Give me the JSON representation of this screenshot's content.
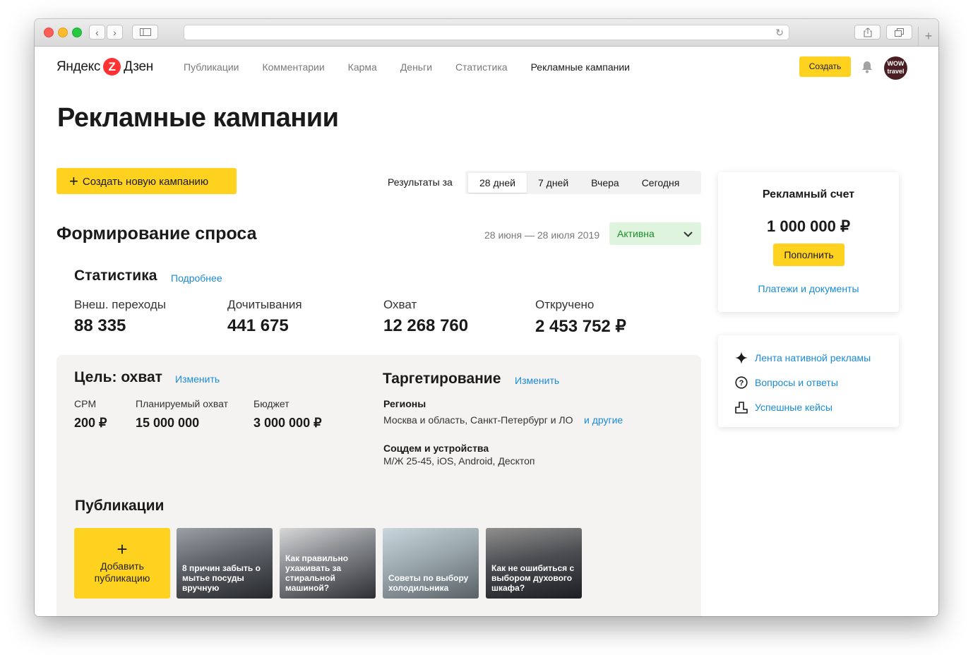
{
  "header": {
    "logo_left": "Яндекс",
    "logo_mark": "Z",
    "logo_right": "Дзен",
    "nav": [
      {
        "label": "Публикации"
      },
      {
        "label": "Комментарии"
      },
      {
        "label": "Карма"
      },
      {
        "label": "Деньги"
      },
      {
        "label": "Статистика"
      },
      {
        "label": "Рекламные кампании"
      }
    ],
    "create_label": "Создать",
    "avatar_text_1": "WOW",
    "avatar_text_2": "travel"
  },
  "page_title": "Рекламные кампании",
  "toolbar": {
    "new_campaign_label": "Создать новую кампанию",
    "period_label": "Результаты за",
    "periods": [
      {
        "label": "28 дней",
        "selected": true
      },
      {
        "label": "7 дней"
      },
      {
        "label": "Вчера"
      },
      {
        "label": "Сегодня"
      }
    ]
  },
  "campaign": {
    "title": "Формирование спроса",
    "dates": "28 июня — 28 июля 2019",
    "status": "Активна"
  },
  "stats": {
    "title": "Статистика",
    "link": "Подробнее",
    "metrics": [
      {
        "label": "Внеш. переходы",
        "value": "88 335"
      },
      {
        "label": "Дочитывания",
        "value": "441 675"
      },
      {
        "label": "Охват",
        "value": "12 268 760"
      },
      {
        "label": "Откручено",
        "value": "2 453 752 ₽"
      }
    ]
  },
  "goal": {
    "title": "Цель: охват",
    "edit": "Изменить",
    "items": [
      {
        "label": "CPM",
        "value": "200 ₽"
      },
      {
        "label": "Планируемый охват",
        "value": "15 000 000"
      },
      {
        "label": "Бюджет",
        "value": "3 000 000 ₽"
      }
    ]
  },
  "targeting": {
    "title": "Таргетирование",
    "edit": "Изменить",
    "regions_title": "Регионы",
    "regions_value": "Москва и область, Санкт-Петербург и ЛО",
    "regions_more": "и другие",
    "demo_title": "Соцдем и устройства",
    "demo_value": "М/Ж 25-45, iOS, Android, Десктоп"
  },
  "publications": {
    "title": "Публикации",
    "add_label_1": "Добавить",
    "add_label_2": "публикацию",
    "cards": [
      {
        "title": "8 причин забыть о мытье посуды вручную"
      },
      {
        "title": "Как правильно ухаживать за стиральной машиной?"
      },
      {
        "title": "Советы по выбору холодильника"
      },
      {
        "title": "Как не ошибиться с выбором духового шкафа?"
      }
    ]
  },
  "account": {
    "title": "Рекламный счет",
    "amount": "1 000 000 ₽",
    "topup": "Пополнить",
    "link": "Платежи и документы"
  },
  "links": [
    {
      "label": "Лента нативной рекламы",
      "icon": "sparkle-icon"
    },
    {
      "label": "Вопросы и ответы",
      "icon": "question-icon"
    },
    {
      "label": "Успешные кейсы",
      "icon": "podium-icon"
    }
  ],
  "colors": {
    "accent_yellow": "#ffd21f",
    "link_blue": "#1a8bd6",
    "status_green_bg": "#dff4dc",
    "status_green_text": "#1d8c2d"
  }
}
